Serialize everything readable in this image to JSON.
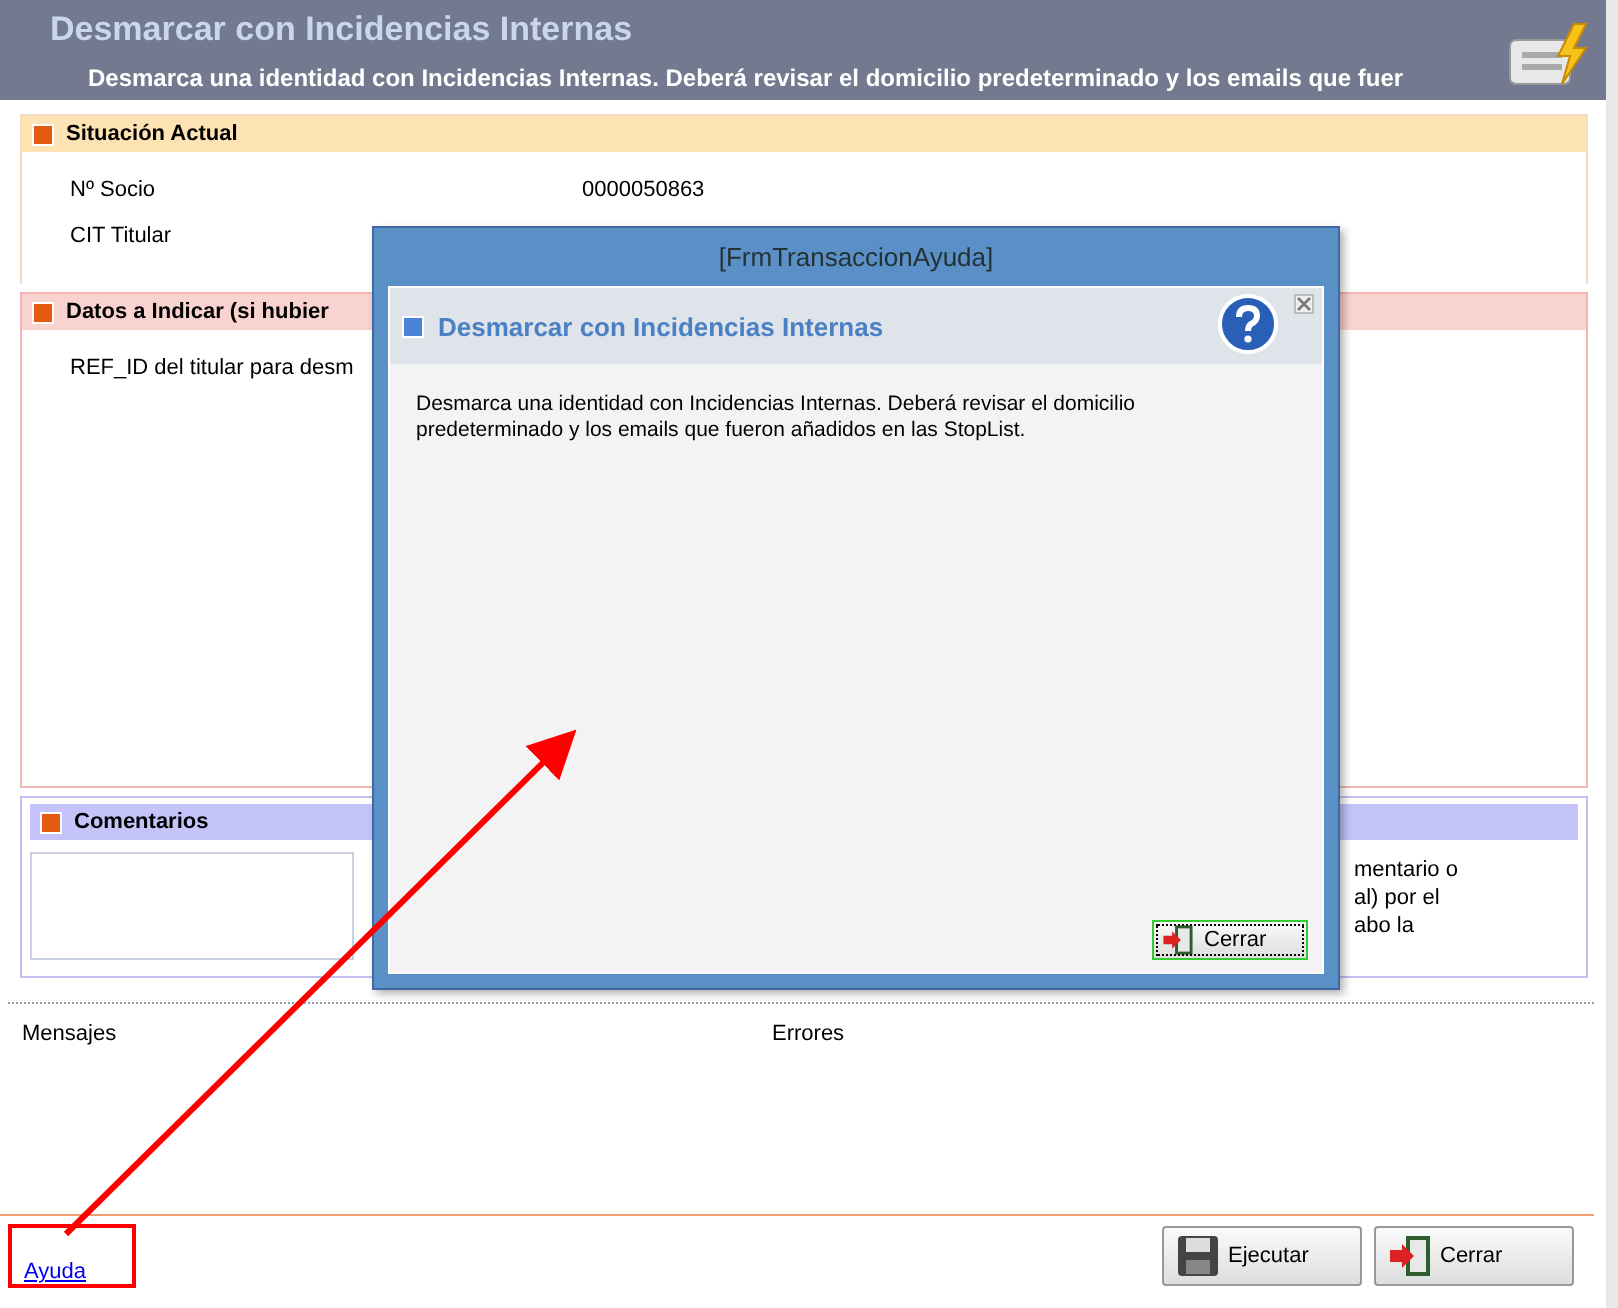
{
  "header": {
    "title": "Desmarcar con Incidencias Internas",
    "subtitle": "Desmarca una identidad con Incidencias Internas. Deberá revisar el domicilio predeterminado y los emails que fuer"
  },
  "sections": [
    {
      "kind": "info",
      "title": "Situación Actual",
      "rows": [
        {
          "label": "Nº Socio",
          "value": "0000050863"
        },
        {
          "label": "CIT Titular"
        }
      ]
    },
    {
      "kind": "input",
      "title": "Datos a Indicar (si hubier",
      "rows": [
        {
          "label": "REF_ID del titular para desm"
        }
      ]
    },
    {
      "kind": "comments",
      "title": "Comentarios",
      "note_lines": [
        "mentario o",
        "al) por el",
        "abo la"
      ]
    }
  ],
  "messages": {
    "left": "Mensajes",
    "right": "Errores"
  },
  "footer": {
    "help_link": "Ayuda",
    "buttons": [
      {
        "label": "Ejecutar",
        "kind": "save"
      },
      {
        "label": "Cerrar",
        "kind": "exit"
      }
    ]
  },
  "dialog": {
    "window_title": "[FrmTransaccionAyuda]",
    "title": "Desmarcar con Incidencias Internas",
    "text": "Desmarca una identidad con Incidencias Internas. Deberá revisar el domicilio predeterminado y los emails que fueron añadidos en las StopList.",
    "button": "Cerrar"
  }
}
